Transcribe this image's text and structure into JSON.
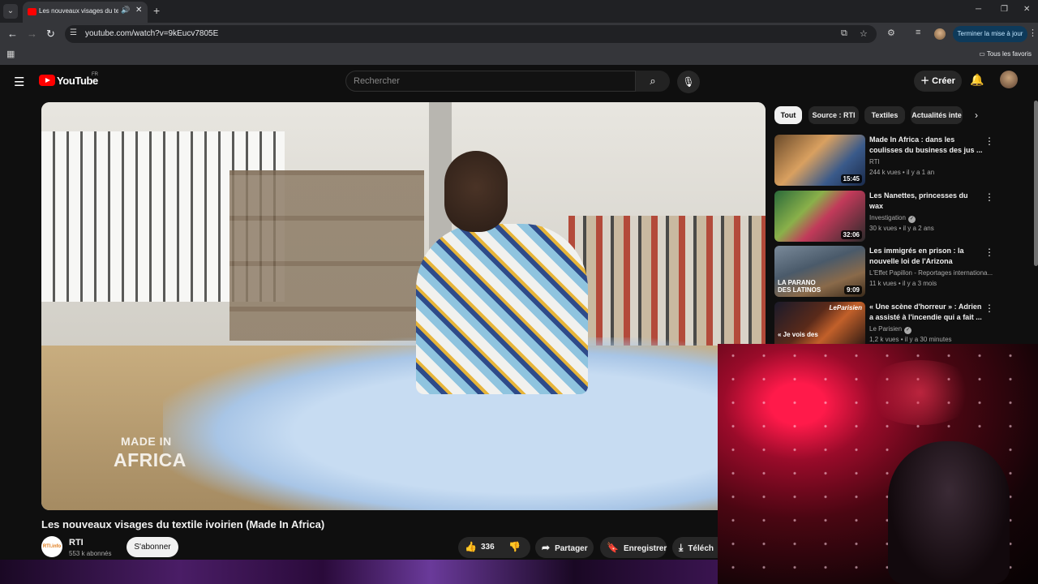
{
  "browser": {
    "tab_title": "Les nouveaux visages du textile ivoirien (Made In Africa)",
    "url": "youtube.com/watch?v=9kEucv7805E",
    "update_button": "Terminer la mise à jour",
    "all_bookmarks": "Tous les favoris"
  },
  "masthead": {
    "logo_text": "YouTube",
    "country": "FR",
    "search_placeholder": "Rechercher",
    "create_label": "Créer"
  },
  "video": {
    "overlay_line1": "MADE IN",
    "overlay_line2": "AFRICA",
    "title": "Les nouveaux visages du textile ivoirien (Made In Africa)",
    "channel": "RTI",
    "channel_avatar": "RTI.info",
    "subscribers": "553 k abonnés",
    "subscribe_label": "S'abonner",
    "likes": "336",
    "share_label": "Partager",
    "save_label": "Enregistrer",
    "download_label": "Téléch"
  },
  "sidebar": {
    "chips": [
      "Tout",
      "Source : RTI",
      "Textiles",
      "Actualités inte"
    ],
    "recommendations": [
      {
        "title": "Made In Africa : dans les coulisses du business des jus ...",
        "channel": "RTI",
        "views": "244 k vues",
        "age": "il y a 1 an",
        "duration": "15:45",
        "verified": false,
        "thumb_text": "",
        "thumb_brand": ""
      },
      {
        "title": "Les Nanettes, princesses du wax",
        "channel": "Investigation",
        "views": "30 k vues",
        "age": "il y a 2 ans",
        "duration": "32:06",
        "verified": true,
        "thumb_text": "",
        "thumb_brand": ""
      },
      {
        "title": "Les immigrés en prison : la nouvelle loi de l'Arizona",
        "channel": "L'Effet Papillon - Reportages internationa...",
        "views": "11 k vues",
        "age": "il y a 3 mois",
        "duration": "9:09",
        "verified": false,
        "thumb_text": "LA PARANO DES LATINOS",
        "thumb_brand": ""
      },
      {
        "title": "« Une scène d'horreur » : Adrien a assisté à l'incendie qui a fait ...",
        "channel": "Le Parisien",
        "views": "1,2 k vues",
        "age": "il y a 30 minutes",
        "duration": "",
        "verified": true,
        "thumb_text": "« Je vois des",
        "thumb_brand": "LeParisien"
      }
    ]
  },
  "colors": {
    "accent": "#ff0000",
    "update_button": "#0e3a5a"
  }
}
